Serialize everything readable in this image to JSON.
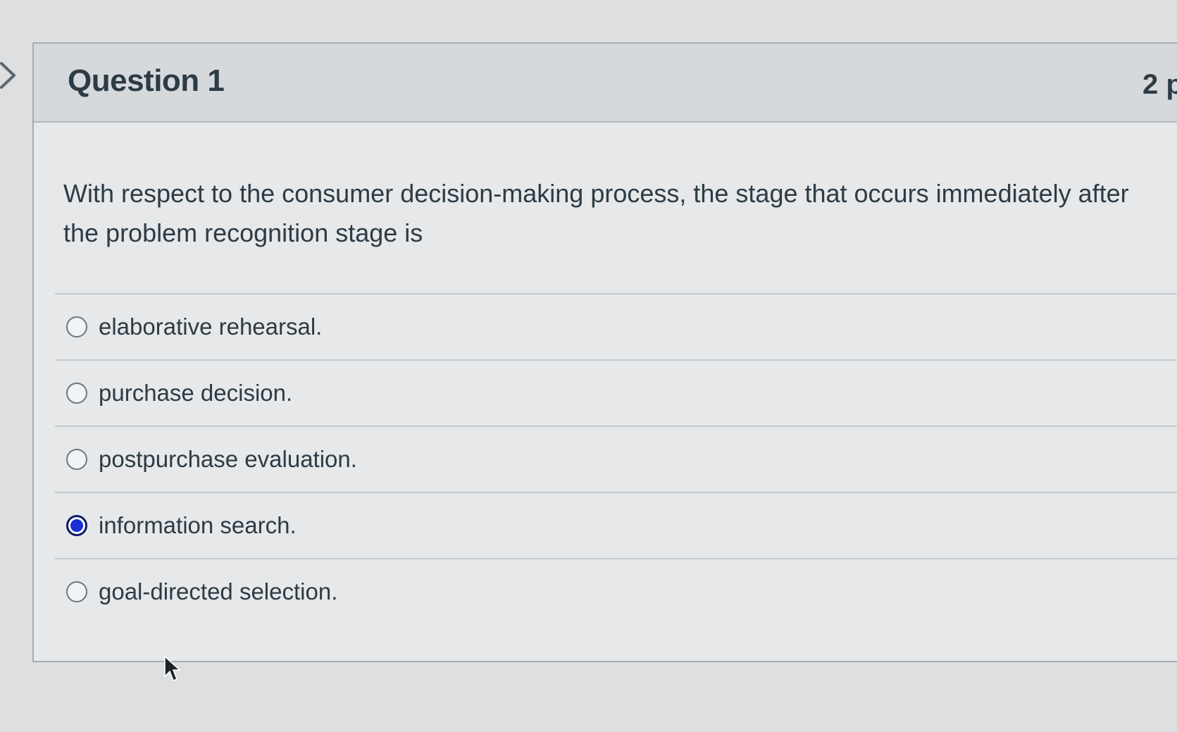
{
  "question": {
    "title": "Question 1",
    "points": "2 p",
    "text": "With respect to the consumer decision-making process, the stage that occurs immediately after the problem recognition stage is",
    "answers": [
      {
        "label": "elaborative rehearsal.",
        "selected": false
      },
      {
        "label": "purchase decision.",
        "selected": false
      },
      {
        "label": "postpurchase evaluation.",
        "selected": false
      },
      {
        "label": "information search.",
        "selected": true
      },
      {
        "label": "goal-directed selection.",
        "selected": false
      }
    ]
  },
  "icons": {
    "collapse": "chevron-right-icon",
    "pointer": "mouse-pointer-icon"
  },
  "colors": {
    "selected_radio": "#1a2fd6",
    "text": "#2d3b45"
  }
}
